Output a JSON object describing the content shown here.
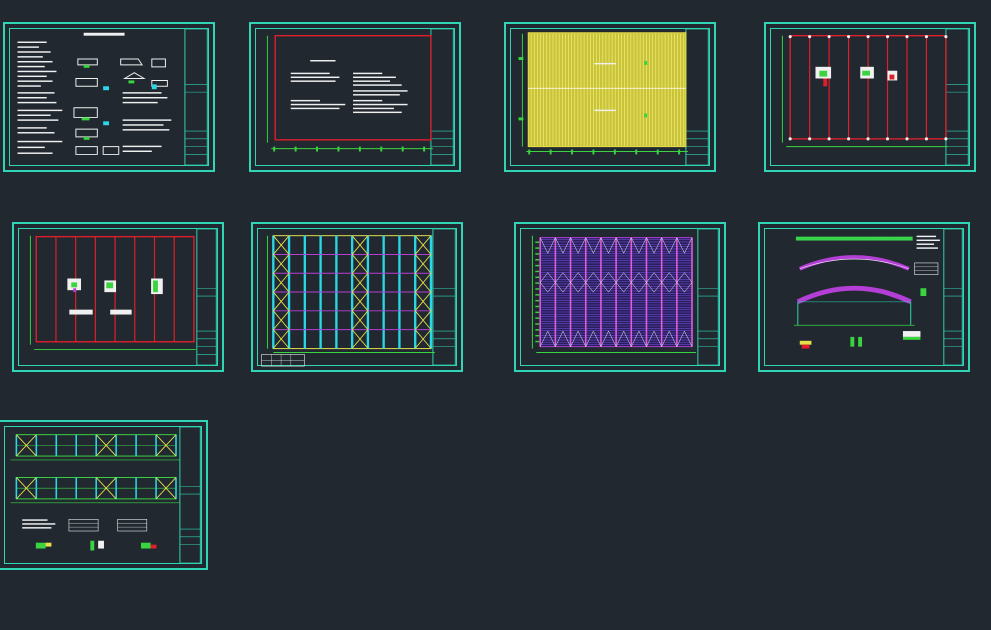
{
  "canvas": {
    "background": "#212830",
    "frame_color": "#2fd5b4"
  },
  "sheets": [
    {
      "id": 1,
      "kind": "notes",
      "label": ""
    },
    {
      "id": 2,
      "kind": "plan-text",
      "label": ""
    },
    {
      "id": 3,
      "kind": "roof-panel",
      "label": ""
    },
    {
      "id": 4,
      "kind": "column-plan",
      "label": ""
    },
    {
      "id": 5,
      "kind": "foundation-plan",
      "label": ""
    },
    {
      "id": 6,
      "kind": "bracing-plan",
      "label": ""
    },
    {
      "id": 7,
      "kind": "purlin-plan",
      "label": ""
    },
    {
      "id": 8,
      "kind": "arch-elevation",
      "label": ""
    },
    {
      "id": 9,
      "kind": "wall-elevations",
      "label": ""
    }
  ],
  "colors": {
    "red": "#e01f2b",
    "yellow": "#e8e04a",
    "green": "#39d43f",
    "magenta": "#b43fd6",
    "cyan": "#2bd7e6",
    "white": "#f0f0f0",
    "blue": "#3a48ff"
  }
}
